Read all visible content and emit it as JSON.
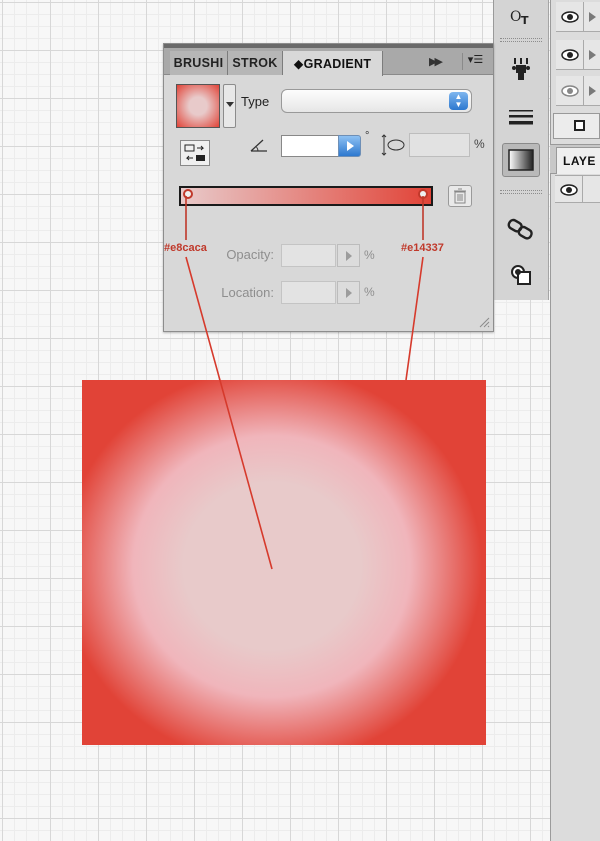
{
  "panel": {
    "tabs": [
      {
        "label": "BRUSHI"
      },
      {
        "label": "STROK"
      },
      {
        "label": "◆GRADIENT"
      }
    ],
    "type_label": "Type",
    "type_value": "",
    "angle_value": "",
    "degree_symbol": "°",
    "aspect_value": "",
    "percent_symbol": "%",
    "opacity_label": "Opacity:",
    "opacity_value": "",
    "location_label": "Location:",
    "location_value": ""
  },
  "gradient": {
    "stop_start_color": "#e8caca",
    "stop_end_color": "#e14337"
  },
  "annotations": {
    "start_color_label": "#e8caca",
    "end_color_label": "#e14337"
  },
  "layers_panel": {
    "tab_label": "LAYE"
  },
  "icons": [
    "eye-icon",
    "type-tool-icon",
    "symbol-sprayer-icon",
    "stroke-lines-icon",
    "gradient-icon",
    "links-icon",
    "appearance-icon",
    "angle-icon",
    "aspect-ratio-icon",
    "reverse-gradient-icon",
    "trash-icon",
    "resize-grip-icon"
  ]
}
